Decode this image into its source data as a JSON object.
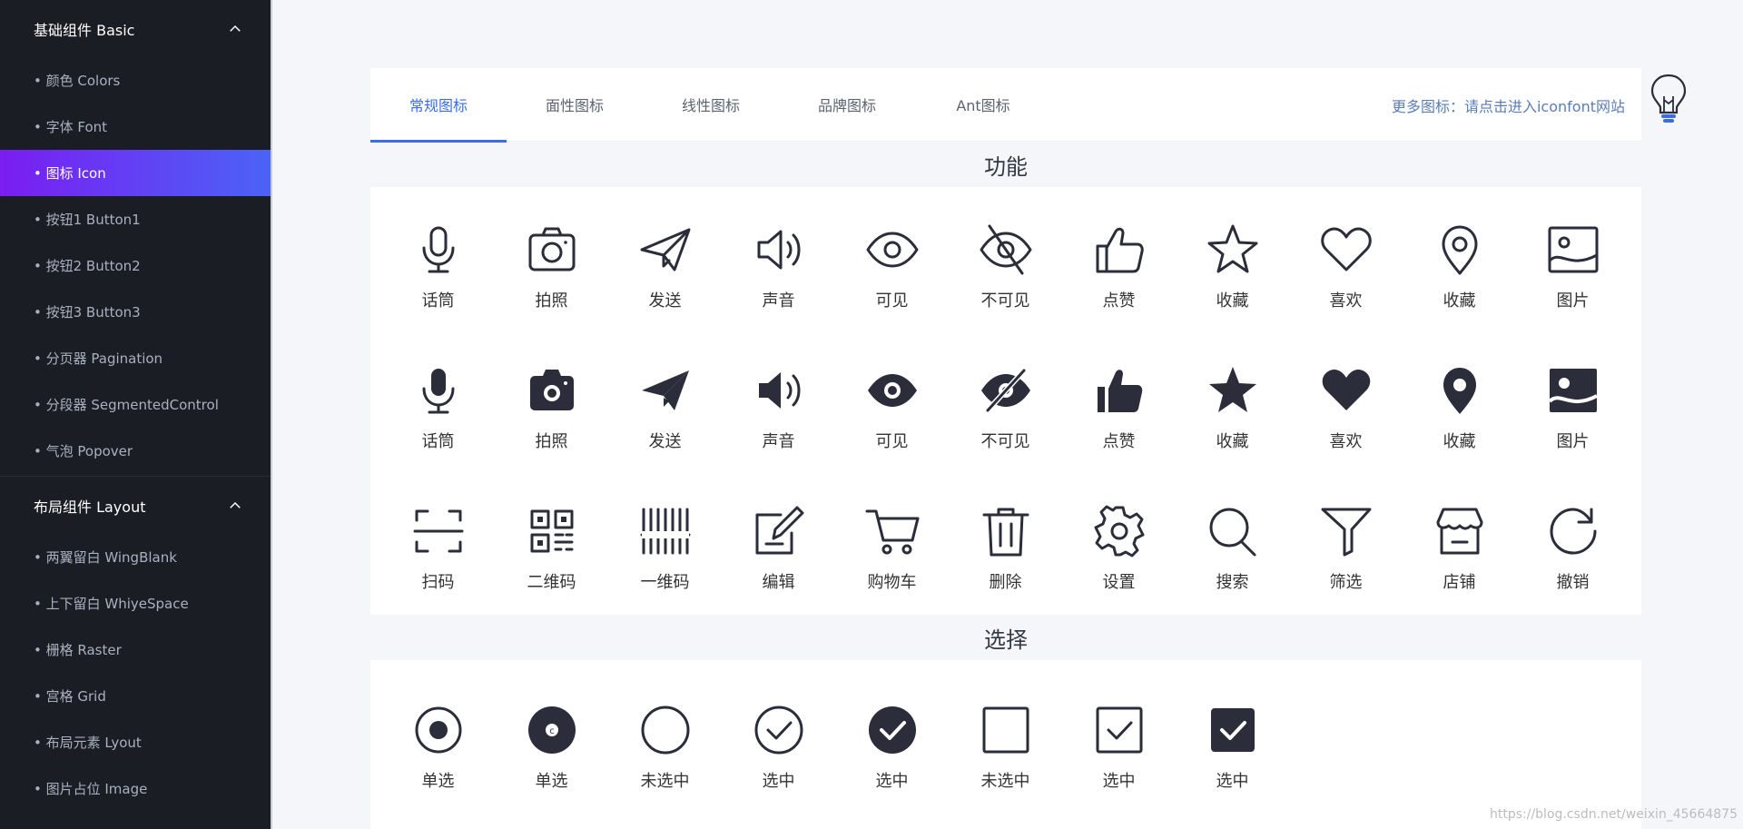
{
  "sidebar": {
    "groups": [
      {
        "title": "基础组件 Basic",
        "items": [
          {
            "label": "• 颜色 Colors"
          },
          {
            "label": "• 字体 Font"
          },
          {
            "label": "• 图标 Icon",
            "active": true
          },
          {
            "label": "• 按钮1 Button1"
          },
          {
            "label": "• 按钮2 Button2"
          },
          {
            "label": "• 按钮3 Button3"
          },
          {
            "label": "• 分页器 Pagination"
          },
          {
            "label": "• 分段器 SegmentedControl"
          },
          {
            "label": "• 气泡 Popover"
          }
        ]
      },
      {
        "title": "布局组件 Layout",
        "items": [
          {
            "label": "• 两翼留白 WingBlank"
          },
          {
            "label": "• 上下留白 WhiyeSpace"
          },
          {
            "label": "• 栅格 Raster"
          },
          {
            "label": "• 宫格 Grid"
          },
          {
            "label": "• 布局元素 Lyout"
          },
          {
            "label": "• 图片占位 Image"
          }
        ]
      }
    ]
  },
  "tabs": [
    {
      "label": "常规图标",
      "active": true
    },
    {
      "label": "面性图标"
    },
    {
      "label": "线性图标"
    },
    {
      "label": "品牌图标"
    },
    {
      "label": "Ant图标"
    }
  ],
  "more_link": "更多图标：请点击进入iconfont网站",
  "sections": {
    "function_title": "功能",
    "select_title": "选择"
  },
  "function_icons": [
    {
      "label": "话筒",
      "icon": "microphone-outline-icon"
    },
    {
      "label": "拍照",
      "icon": "camera-outline-icon"
    },
    {
      "label": "发送",
      "icon": "send-outline-icon"
    },
    {
      "label": "声音",
      "icon": "volume-outline-icon"
    },
    {
      "label": "可见",
      "icon": "eye-outline-icon"
    },
    {
      "label": "不可见",
      "icon": "eye-off-outline-icon"
    },
    {
      "label": "点赞",
      "icon": "thumbs-up-outline-icon"
    },
    {
      "label": "收藏",
      "icon": "star-outline-icon"
    },
    {
      "label": "喜欢",
      "icon": "heart-outline-icon"
    },
    {
      "label": "收藏",
      "icon": "location-outline-icon"
    },
    {
      "label": "图片",
      "icon": "image-outline-icon"
    },
    {
      "label": "话筒",
      "icon": "microphone-filled-icon"
    },
    {
      "label": "拍照",
      "icon": "camera-filled-icon"
    },
    {
      "label": "发送",
      "icon": "send-filled-icon"
    },
    {
      "label": "声音",
      "icon": "volume-filled-icon"
    },
    {
      "label": "可见",
      "icon": "eye-filled-icon"
    },
    {
      "label": "不可见",
      "icon": "eye-off-filled-icon"
    },
    {
      "label": "点赞",
      "icon": "thumbs-up-filled-icon"
    },
    {
      "label": "收藏",
      "icon": "star-filled-icon"
    },
    {
      "label": "喜欢",
      "icon": "heart-filled-icon"
    },
    {
      "label": "收藏",
      "icon": "location-filled-icon"
    },
    {
      "label": "图片",
      "icon": "image-filled-icon"
    },
    {
      "label": "扫码",
      "icon": "scan-icon"
    },
    {
      "label": "二维码",
      "icon": "qrcode-icon"
    },
    {
      "label": "一维码",
      "icon": "barcode-icon"
    },
    {
      "label": "编辑",
      "icon": "edit-icon"
    },
    {
      "label": "购物车",
      "icon": "cart-icon"
    },
    {
      "label": "删除",
      "icon": "trash-icon"
    },
    {
      "label": "设置",
      "icon": "gear-icon"
    },
    {
      "label": "搜索",
      "icon": "search-icon"
    },
    {
      "label": "筛选",
      "icon": "filter-icon"
    },
    {
      "label": "店铺",
      "icon": "store-icon"
    },
    {
      "label": "撤销",
      "icon": "undo-icon"
    }
  ],
  "select_icons": [
    {
      "label": "单选",
      "icon": "radio-checked-outline-icon"
    },
    {
      "label": "单选",
      "icon": "radio-checked-filled-icon"
    },
    {
      "label": "未选中",
      "icon": "circle-unchecked-icon"
    },
    {
      "label": "选中",
      "icon": "circle-check-outline-icon"
    },
    {
      "label": "选中",
      "icon": "circle-check-filled-icon"
    },
    {
      "label": "未选中",
      "icon": "square-unchecked-icon"
    },
    {
      "label": "选中",
      "icon": "square-check-outline-icon"
    },
    {
      "label": "选中",
      "icon": "square-check-filled-icon"
    }
  ],
  "watermark": "https://blog.csdn.net/weixin_45664875",
  "colors": {
    "accent": "#3a6ee8",
    "sidebar_bg": "#1b1d24",
    "icon": "#2b2d3a"
  }
}
